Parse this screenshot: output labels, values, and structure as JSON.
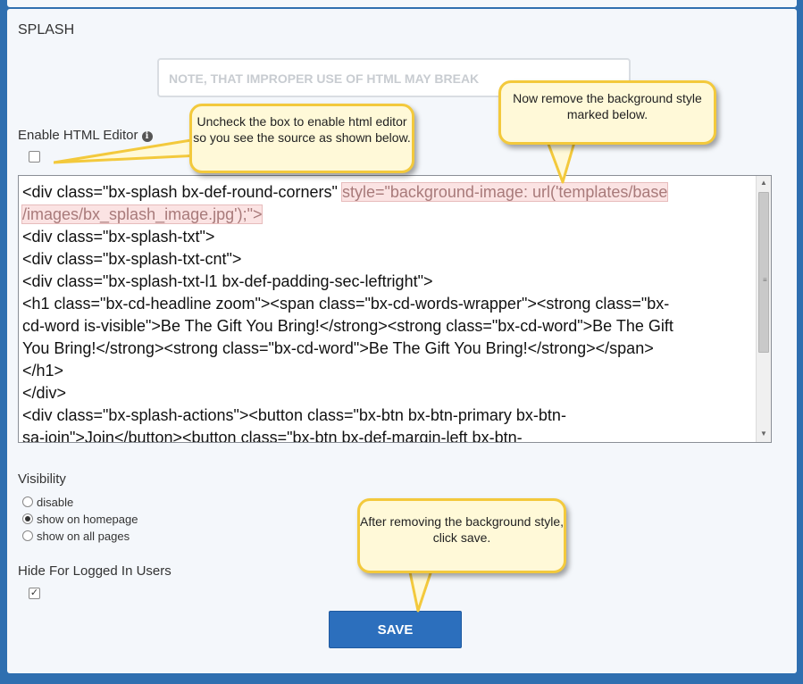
{
  "section": {
    "title": "SPLASH"
  },
  "warning": {
    "text": "NOTE, THAT IMPROPER USE OF HTML MAY BREAK"
  },
  "html_editor": {
    "label": "Enable HTML Editor",
    "checked": false
  },
  "editor": {
    "lines": [
      "/images/bx_splash_image.jpg');\">",
      "<div class=\"bx-splash-txt\">",
      "<div class=\"bx-splash-txt-cnt\">",
      "<div class=\"bx-splash-txt-l1 bx-def-padding-sec-leftright\">",
      "<h1 class=\"bx-cd-headline zoom\"><span class=\"bx-cd-words-wrapper\"><strong class=\"bx-",
      "cd-word is-visible\">Be The Gift You Bring!</strong><strong class=\"bx-cd-word\">Be The Gift",
      "You Bring!</strong><strong class=\"bx-cd-word\">Be The Gift You Bring!</strong></span>",
      "</h1>",
      "</div>",
      "<div class=\"bx-splash-actions\"><button class=\"bx-btn bx-btn-primary bx-btn-",
      "sa-join\">Join</button><button class=\"bx-btn bx-def-margin-left bx-btn-"
    ],
    "first_line_plain": "<div class=\"bx-splash bx-def-round-corners\" ",
    "first_line_highlight": "style=\"background-image: url('templates/base"
  },
  "visibility": {
    "label": "Visibility",
    "options": [
      "disable",
      "show on homepage",
      "show on all pages"
    ],
    "selected": "show on homepage"
  },
  "hide_logged": {
    "label": "Hide For Logged In Users",
    "checked": true
  },
  "save": {
    "label": "SAVE"
  },
  "callouts": {
    "c1": "Uncheck the box to enable html editor so you see the source as shown below.",
    "c2": "Now remove the background style marked below.",
    "c3": "After removing the background style, click save."
  },
  "colors": {
    "accent": "#2c6fbd",
    "callout_border": "#f3c93c",
    "callout_fill": "#fff9d8",
    "highlight": "#fbe3e3"
  }
}
